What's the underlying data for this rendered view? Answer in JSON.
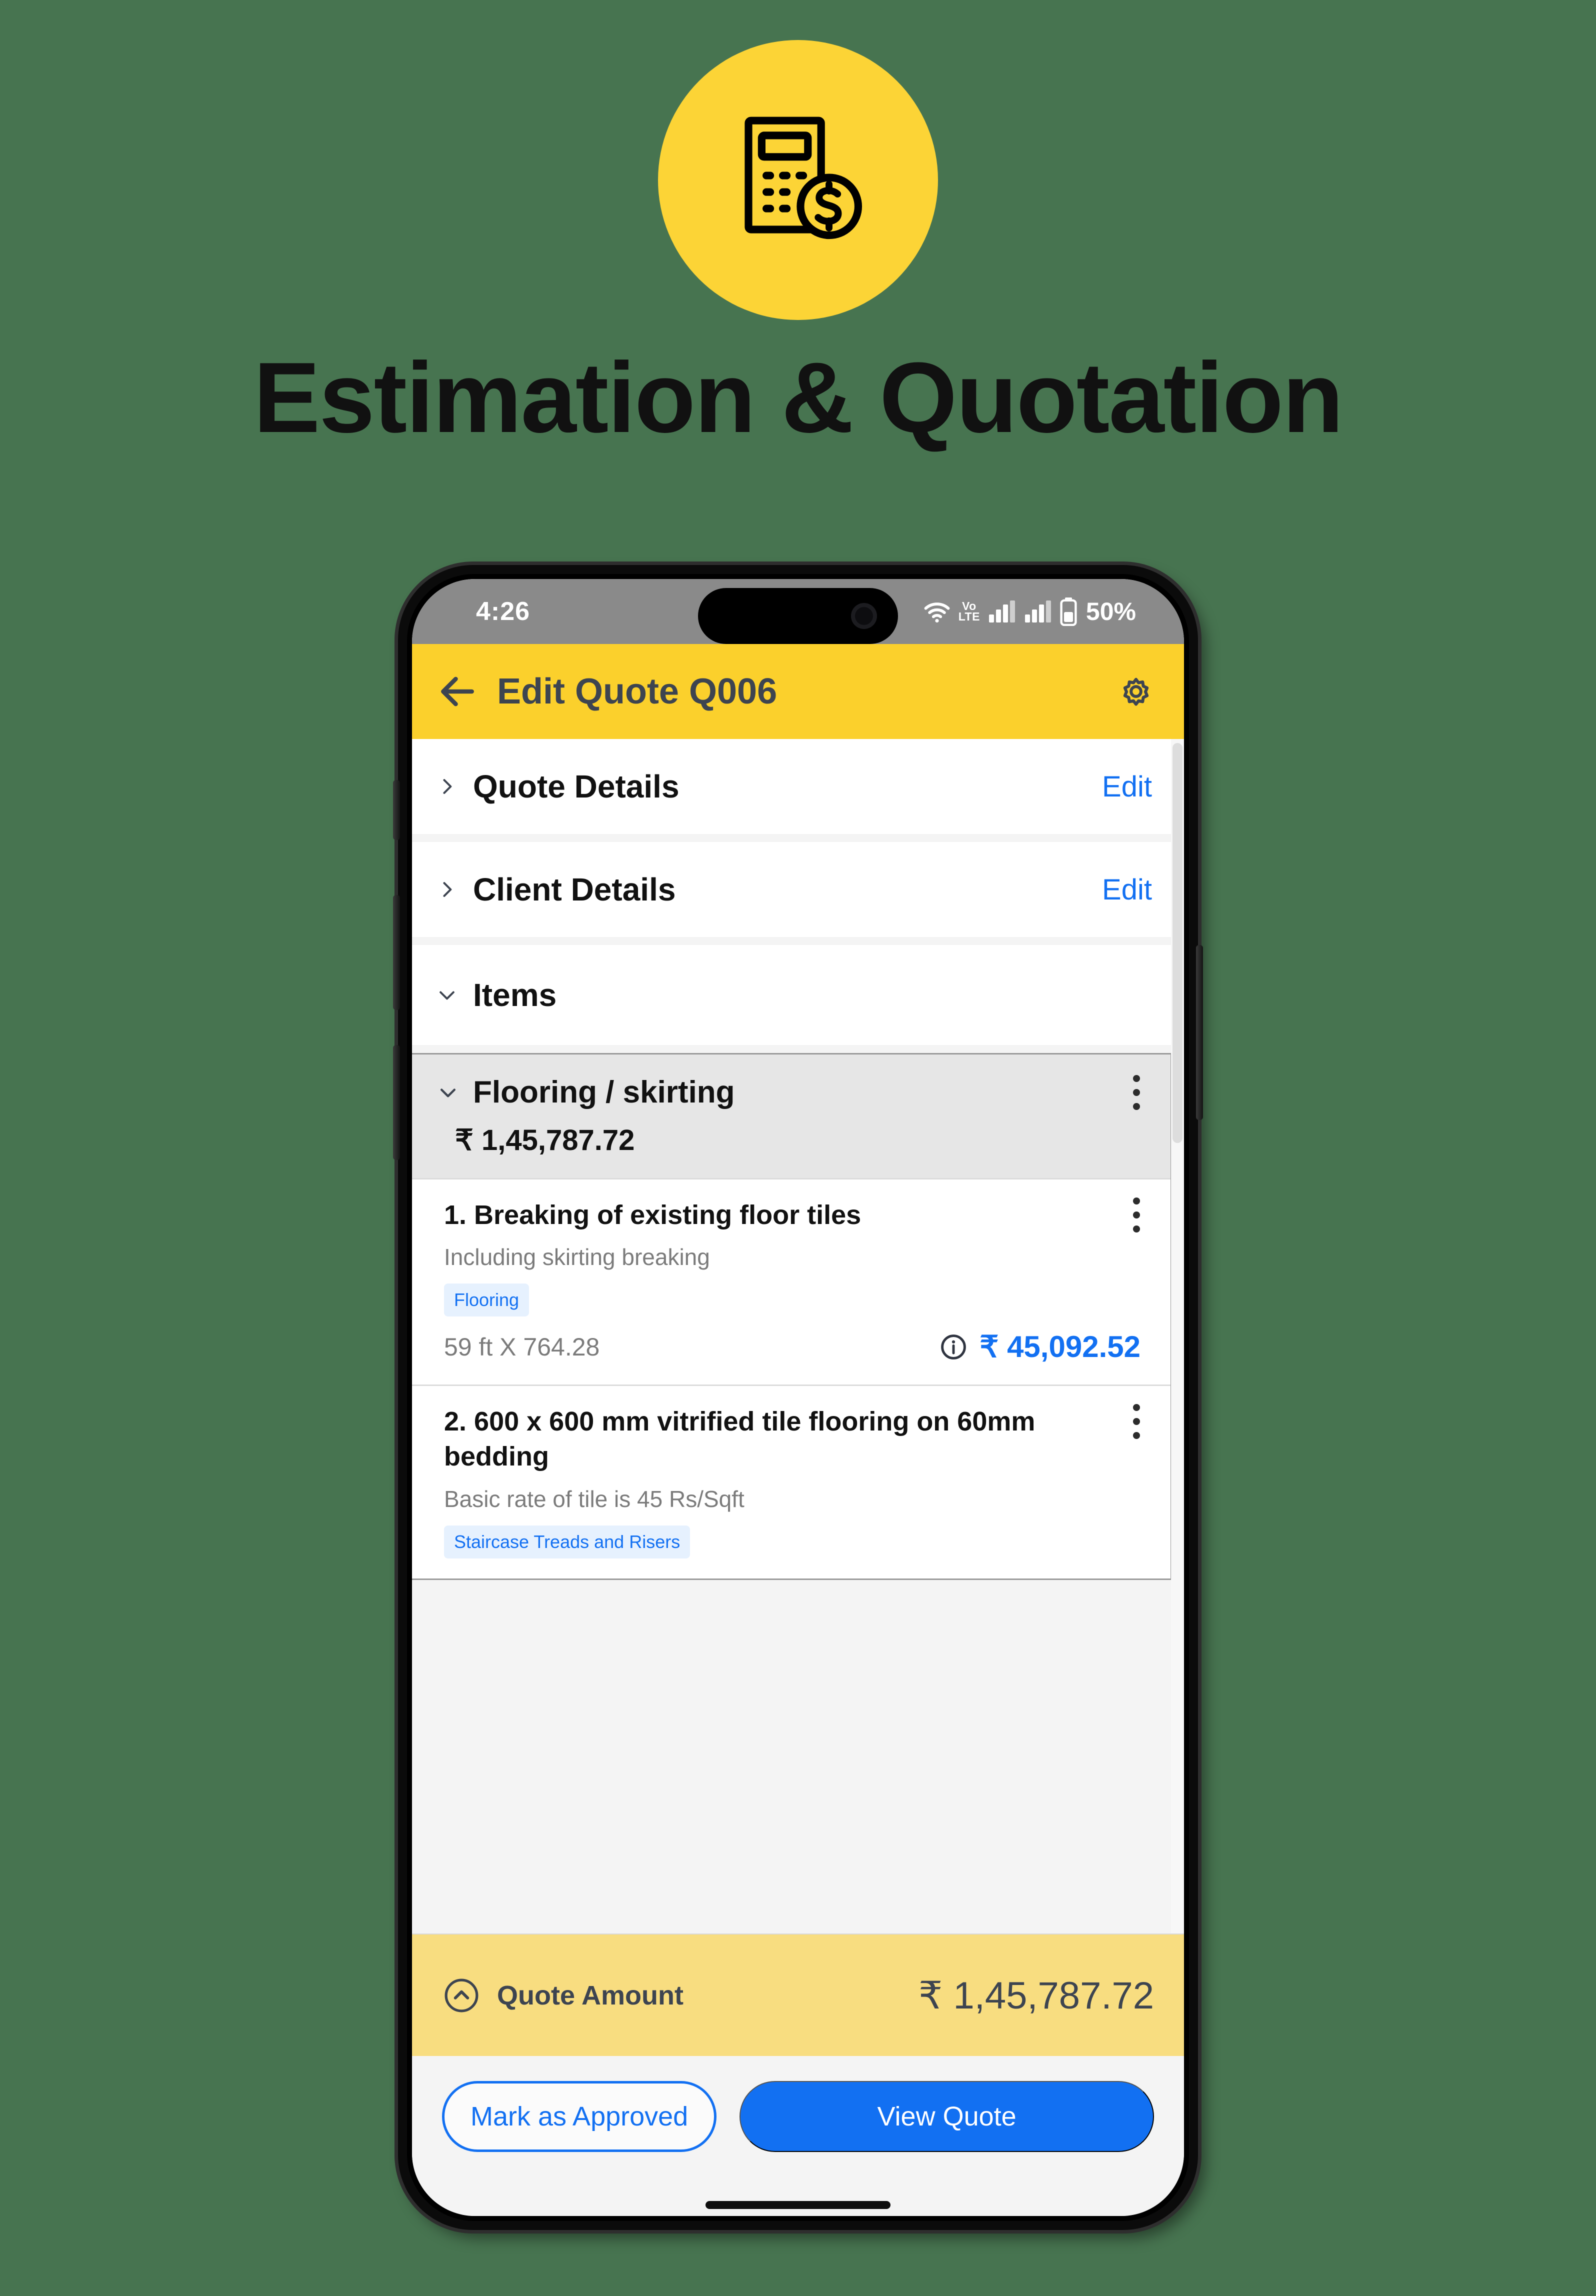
{
  "hero": {
    "title": "Estimation & Quotation",
    "icon": "calculator-dollar-icon",
    "badge_color": "#FCD436",
    "background_color": "#477450"
  },
  "statusbar": {
    "time": "4:26",
    "wifi_icon": "wifi-icon",
    "network_label": "Vo LTE",
    "signal_icon_1": "signal-bars-icon",
    "signal_icon_2": "signal-bars-icon",
    "battery_icon": "battery-icon",
    "battery_percent": "50%"
  },
  "appbar": {
    "back_icon": "back-arrow-icon",
    "title": "Edit Quote Q006",
    "settings_icon": "gear-icon",
    "background_color": "#FBD02C"
  },
  "sections": [
    {
      "label": "Quote Details",
      "chevron": "chevron-right-icon",
      "action": "Edit"
    },
    {
      "label": "Client Details",
      "chevron": "chevron-right-icon",
      "action": "Edit"
    },
    {
      "label": "Items",
      "chevron": "chevron-down-icon",
      "action": ""
    }
  ],
  "group": {
    "title": "Flooring / skirting",
    "total": "₹ 1,45,787.72",
    "chevron": "chevron-down-icon",
    "menu_icon": "kebab-menu-icon"
  },
  "items": [
    {
      "title": "1. Breaking of existing floor tiles",
      "description": "Including skirting breaking",
      "tag": "Flooring",
      "quantity": "59 ft X 764.28",
      "price": "₹ 45,092.52",
      "info_icon": "info-icon",
      "menu_icon": "kebab-menu-icon"
    },
    {
      "title": "2. 600 x 600 mm vitrified tile flooring on 60mm bedding",
      "description": "Basic rate of tile is 45 Rs/Sqft",
      "tag": "Staircase Treads and Risers",
      "quantity": "",
      "price": "",
      "info_icon": "info-icon",
      "menu_icon": "kebab-menu-icon"
    }
  ],
  "quote_bar": {
    "toggle_icon": "chevron-up-circle-icon",
    "label": "Quote Amount",
    "value": "₹ 1,45,787.72",
    "background_color": "#F8DD80"
  },
  "actions": {
    "secondary_label": "Mark as Approved",
    "primary_label": "View Quote",
    "accent_color": "#1270F2"
  }
}
